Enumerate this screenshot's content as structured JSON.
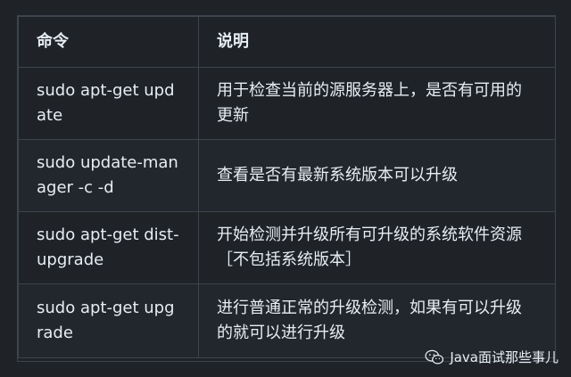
{
  "table": {
    "headers": [
      "命令",
      "说明"
    ],
    "rows": [
      {
        "command": "sudo apt-get update",
        "desc": "用于检查当前的源服务器上，是否有可用的更新"
      },
      {
        "command": "sudo update-manager -c -d",
        "desc": "查看是否有最新系统版本可以升级"
      },
      {
        "command": "sudo apt-get dist-upgrade",
        "desc": "开始检测并升级所有可升级的系统软件资源［不包括系统版本］"
      },
      {
        "command": "sudo apt-get upgrade",
        "desc": "进行普通正常的升级检测，如果有可以升级的就可以进行升级"
      }
    ]
  },
  "watermark": {
    "text": "Java面试那些事儿",
    "icon": "wechat-icon"
  },
  "colors": {
    "background": "#1f2328",
    "border": "#3d444d",
    "text": "#e6edf3"
  }
}
